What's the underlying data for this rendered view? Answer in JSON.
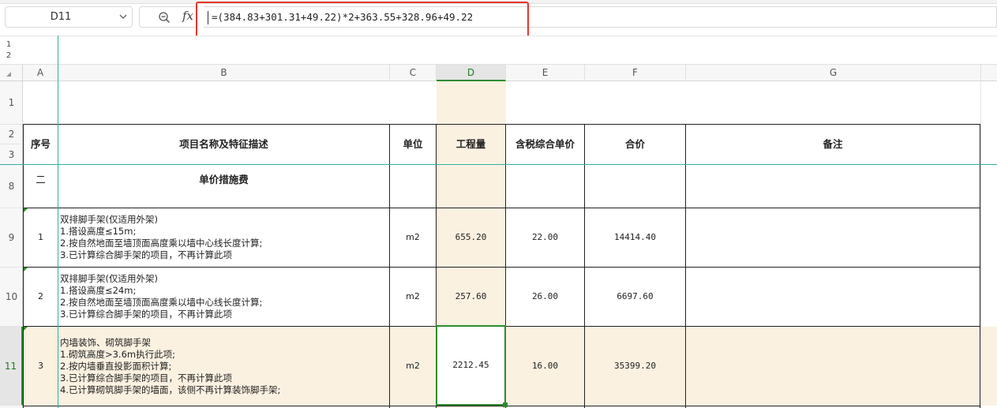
{
  "name_box": {
    "cell_ref": "D11"
  },
  "formula_bar": {
    "fx_label": "fx",
    "formula": "=(384.83+301.31+49.22)*2+363.55+328.96+49.22"
  },
  "outline_levels": [
    "1",
    "2"
  ],
  "columns": [
    "A",
    "B",
    "C",
    "D",
    "E",
    "F",
    "G"
  ],
  "row_headers": [
    "1",
    "2",
    "3",
    "8",
    "9",
    "10",
    "11"
  ],
  "table_header": {
    "seq": "序号",
    "name": "项目名称及特征描述",
    "unit": "单位",
    "qty": "工程量",
    "unit_price": "含税综合单价",
    "total": "合价",
    "remark": "备注"
  },
  "section": {
    "seq": "二",
    "name": "单价措施费"
  },
  "rows": [
    {
      "seq": "1",
      "name": "双排脚手架(仅适用外架)\n1.搭设高度≤15m;\n2.按自然地面至墙顶面高度乘以墙中心线长度计算;\n3.已计算综合脚手架的项目，不再计算此项",
      "unit": "m2",
      "qty": "655.20",
      "unit_price": "22.00",
      "total": "14414.40"
    },
    {
      "seq": "2",
      "name": "双排脚手架(仅适用外架)\n1.搭设高度≤24m;\n2.按自然地面至墙顶面高度乘以墙中心线长度计算;\n3.已计算综合脚手架的项目，不再计算此项",
      "unit": "m2",
      "qty": "257.60",
      "unit_price": "26.00",
      "total": "6697.60"
    },
    {
      "seq": "3",
      "name": "内墙装饰、砌筑脚手架\n1.砌筑高度>3.6m执行此项;\n2.按内墙垂直投影面积计算;\n3.已计算综合脚手架的项目，不再计算此项\n4.已计算砌筑脚手架的墙面，该侧不再计算装饰脚手架;",
      "unit": "m2",
      "qty": "2212.45",
      "unit_price": "16.00",
      "total": "35399.20"
    }
  ],
  "colors": {
    "accent_green": "#2e8b2e",
    "qty_column_fill": "#fbf1e1",
    "highlight_red": "#e8342b",
    "guide_teal": "#2fb0a3"
  }
}
